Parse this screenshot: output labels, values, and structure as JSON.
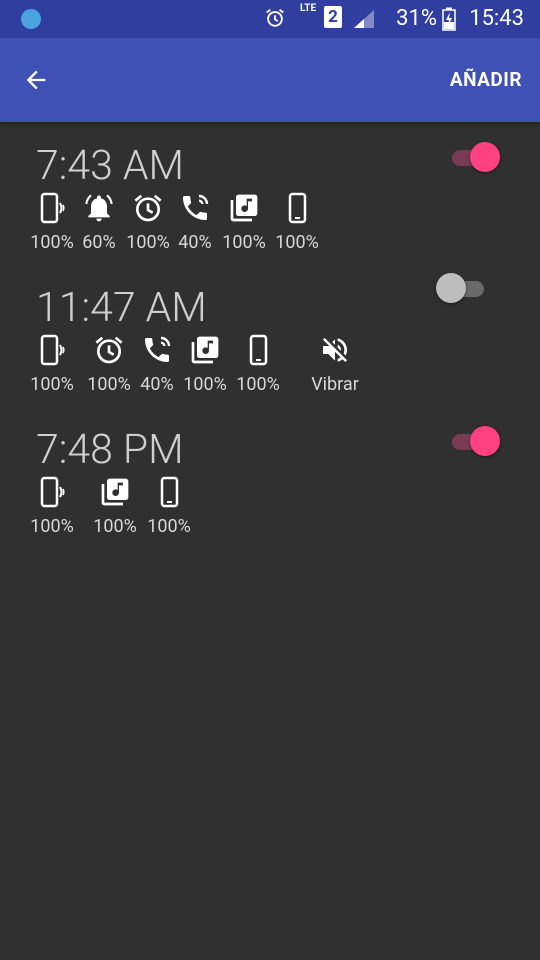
{
  "status_bar": {
    "network": "LTE",
    "sim_slot": "2",
    "battery": "31%",
    "time": "15:43"
  },
  "app_bar": {
    "back_icon": "arrow-back-icon",
    "add_label": "AÑADIR"
  },
  "colors": {
    "primary": "#3f51b5",
    "primary_dark": "#303f9f",
    "accent": "#ff4081",
    "background": "#303030"
  },
  "alarms": [
    {
      "time": "7:43 AM",
      "enabled": true,
      "volumes": [
        {
          "icon": "vibrate-phone-icon",
          "label": "100%"
        },
        {
          "icon": "bell-icon",
          "label": "60%"
        },
        {
          "icon": "alarm-clock-icon",
          "label": "100%"
        },
        {
          "icon": "phone-call-icon",
          "label": "40%"
        },
        {
          "icon": "music-library-icon",
          "label": "100%"
        },
        {
          "icon": "phone-icon",
          "label": "100%"
        }
      ]
    },
    {
      "time": "11:47 AM",
      "enabled": false,
      "volumes": [
        {
          "icon": "vibrate-phone-icon",
          "label": "100%"
        },
        {
          "icon": "alarm-clock-icon",
          "label": "100%"
        },
        {
          "icon": "phone-call-icon",
          "label": "40%"
        },
        {
          "icon": "music-library-icon",
          "label": "100%"
        },
        {
          "icon": "phone-icon",
          "label": "100%"
        },
        {
          "icon": "volume-off-icon",
          "label": "Vibrar"
        }
      ]
    },
    {
      "time": "7:48 PM",
      "enabled": true,
      "volumes": [
        {
          "icon": "vibrate-phone-icon",
          "label": "100%"
        },
        {
          "icon": "music-library-icon",
          "label": "100%"
        },
        {
          "icon": "phone-icon",
          "label": "100%"
        }
      ]
    }
  ]
}
